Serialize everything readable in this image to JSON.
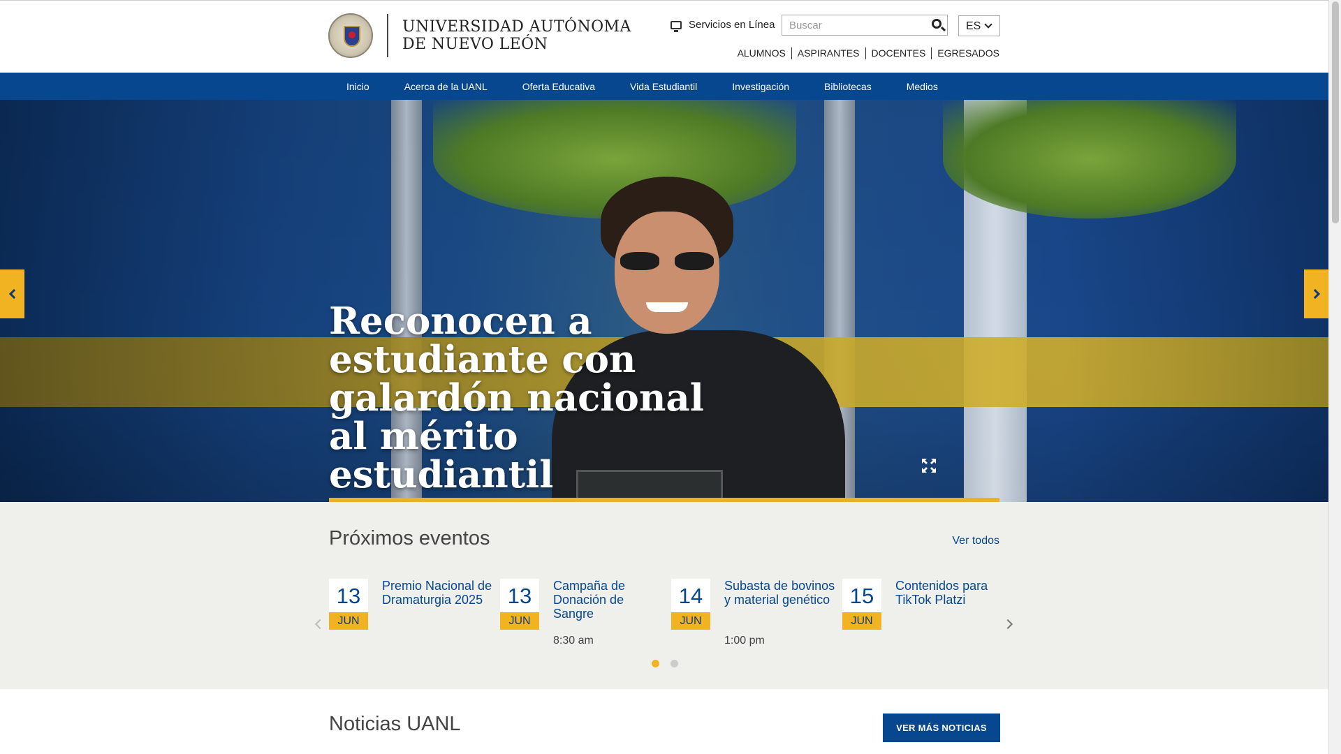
{
  "header": {
    "university_name_line1": "UNIVERSIDAD AUTÓNOMA",
    "university_name_line2": "DE NUEVO LEÓN",
    "services_label": "Servicios en Línea",
    "search_placeholder": "Buscar",
    "language": "ES",
    "audience_links": [
      "ALUMNOS",
      "ASPIRANTES",
      "DOCENTES",
      "EGRESADOS"
    ]
  },
  "nav": {
    "items": [
      "Inicio",
      "Acerca de la UANL",
      "Oferta Educativa",
      "Vida Estudiantil",
      "Investigación",
      "Bibliotecas",
      "Medios"
    ]
  },
  "hero": {
    "headline": "Reconocen a estudiante con galardón nacional al mérito estudiantil"
  },
  "events": {
    "heading": "Próximos eventos",
    "view_all": "Ver todos",
    "items": [
      {
        "day": "13",
        "month": "JUN",
        "title": "Premio Nacional de Dramaturgia 2025",
        "time": ""
      },
      {
        "day": "13",
        "month": "JUN",
        "title": "Campaña de Donación de Sangre",
        "time": "8:30 am"
      },
      {
        "day": "14",
        "month": "JUN",
        "title": "Subasta de bovinos y material genético",
        "time": "1:00 pm"
      },
      {
        "day": "15",
        "month": "JUN",
        "title": "Contenidos para TikTok Platzi",
        "time": ""
      }
    ],
    "pages": 2,
    "active_page": 1
  },
  "news": {
    "heading": "Noticias UANL",
    "more_button": "VER MÁS NOTICIAS"
  },
  "colors": {
    "brand_blue": "#06478f",
    "accent_gold": "#f1b321"
  },
  "icons": {
    "services": "monitor-icon",
    "search": "search-icon",
    "language": "chevron-down-icon",
    "hero_prev": "chevron-left-icon",
    "hero_next": "chevron-right-icon",
    "expand": "expand-icon"
  }
}
